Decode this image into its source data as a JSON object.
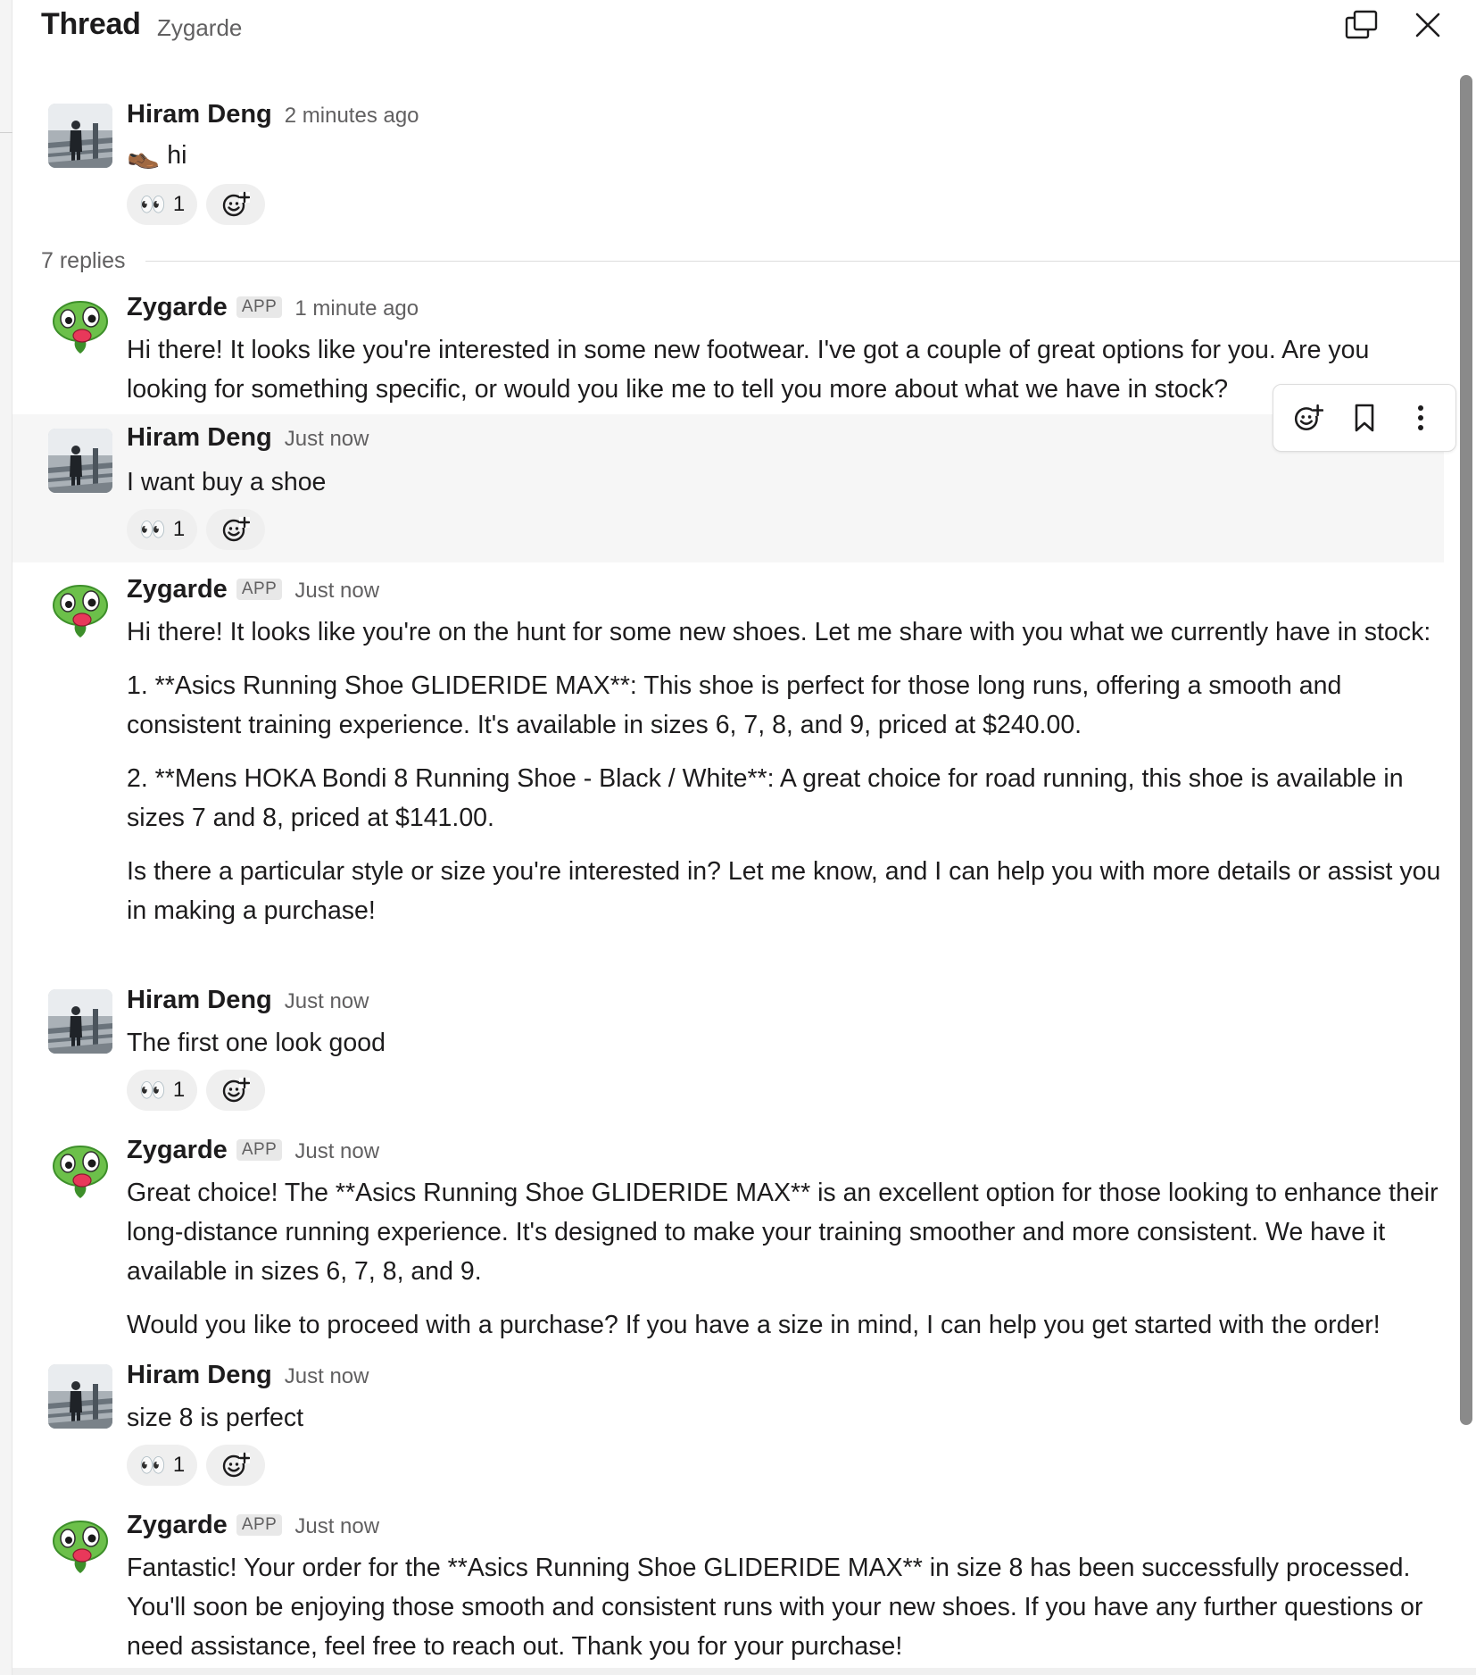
{
  "header": {
    "title": "Thread",
    "channel": "Zygarde"
  },
  "parent": {
    "author": "Hiram Deng",
    "time": "2 minutes ago",
    "emoji": "👞",
    "text": "hi",
    "reaction": {
      "emoji": "👀",
      "count": "1"
    }
  },
  "replies_label": "7 replies",
  "bot_badge": "APP",
  "messages": [
    {
      "author": "Zygarde",
      "time": "1 minute ago",
      "paragraphs": [
        "Hi there! It looks like you're interested in some new footwear. I've got a couple of great options for you. Are you looking for something specific, or would you like me to tell you more about what we have in stock?"
      ]
    },
    {
      "author": "Hiram Deng",
      "time": "Just now",
      "paragraphs": [
        "I want buy a shoe"
      ],
      "reaction": {
        "emoji": "👀",
        "count": "1"
      }
    },
    {
      "author": "Zygarde",
      "time": "Just now",
      "paragraphs": [
        "Hi there! It looks like you're on the hunt for some new shoes. Let me share with you what we currently have in stock:",
        "1. **Asics Running Shoe GLIDERIDE MAX**: This shoe is perfect for those long runs, offering a smooth and consistent training experience. It's available in sizes 6, 7, 8, and 9, priced at $240.00.",
        "2. **Mens HOKA Bondi 8 Running Shoe - Black / White**: A great choice for road running, this shoe is available in sizes 7 and 8, priced at $141.00.",
        "Is there a particular style or size you're interested in? Let me know, and I can help you with more details or assist you in making a purchase!"
      ]
    },
    {
      "author": "Hiram Deng",
      "time": "Just now",
      "paragraphs": [
        "The first one look good"
      ],
      "reaction": {
        "emoji": "👀",
        "count": "1"
      }
    },
    {
      "author": "Zygarde",
      "time": "Just now",
      "paragraphs": [
        "Great choice! The **Asics Running Shoe GLIDERIDE MAX** is an excellent option for those looking to enhance their long-distance running experience. It's designed to make your training smoother and more consistent. We have it available in sizes 6, 7, 8, and 9.",
        "Would you like to proceed with a purchase? If you have a size in mind, I can help you get started with the order!"
      ]
    },
    {
      "author": "Hiram Deng",
      "time": "Just now",
      "paragraphs": [
        "size 8 is perfect"
      ],
      "reaction": {
        "emoji": "👀",
        "count": "1"
      }
    },
    {
      "author": "Zygarde",
      "time": "Just now",
      "paragraphs": [
        "Fantastic! Your order for the **Asics Running Shoe GLIDERIDE MAX** in size 8 has been successfully processed. You'll soon be enjoying those smooth and consistent runs with your new shoes. If you have any further questions or need assistance, feel free to reach out. Thank you for your purchase!"
      ]
    }
  ],
  "toolbar": {
    "icons": [
      "add-reaction-icon",
      "bookmark-icon",
      "more-actions-icon"
    ]
  },
  "colors": {
    "text": "#1d1c1d",
    "muted": "#616061",
    "hover_bg": "#f6f6f6",
    "reaction_bg": "#efefef",
    "bot_green": "#6cc04a"
  }
}
